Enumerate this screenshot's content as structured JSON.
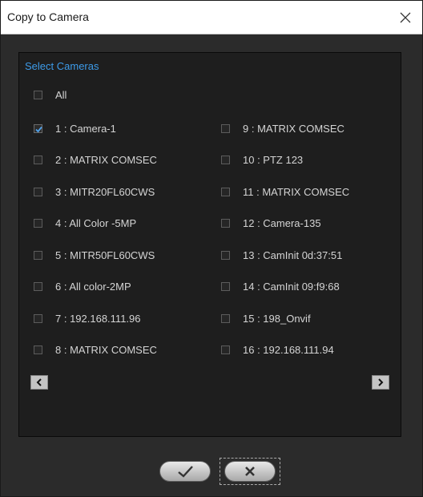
{
  "window": {
    "title": "Copy to Camera"
  },
  "panel": {
    "section_label": "Select Cameras"
  },
  "all_option": {
    "label": "All",
    "checked": false
  },
  "cameras_left": [
    {
      "label": "1 : Camera-1",
      "checked": true
    },
    {
      "label": "2 : MATRIX COMSEC",
      "checked": false
    },
    {
      "label": "3 : MITR20FL60CWS",
      "checked": false
    },
    {
      "label": "4 : All Color -5MP",
      "checked": false
    },
    {
      "label": "5 : MITR50FL60CWS",
      "checked": false
    },
    {
      "label": "6 : All color-2MP",
      "checked": false
    },
    {
      "label": "7 : 192.168.111.96",
      "checked": false
    },
    {
      "label": "8 : MATRIX COMSEC",
      "checked": false
    }
  ],
  "cameras_right": [
    {
      "label": "9 : MATRIX COMSEC",
      "checked": false
    },
    {
      "label": "10 : PTZ 123",
      "checked": false
    },
    {
      "label": "11 : MATRIX COMSEC",
      "checked": false
    },
    {
      "label": "12 : Camera-135",
      "checked": false
    },
    {
      "label": "13 : CamInit 0d:37:51",
      "checked": false
    },
    {
      "label": "14 : CamInit 09:f9:68",
      "checked": false
    },
    {
      "label": "15 : 198_Onvif",
      "checked": false
    },
    {
      "label": "16 : 192.168.111.94",
      "checked": false
    }
  ],
  "icons": {
    "close": "close-icon",
    "prev": "chevron-left-icon",
    "next": "chevron-right-icon",
    "ok": "checkmark-icon",
    "cancel": "x-icon"
  },
  "colors": {
    "background": "#2b2b2b",
    "panel": "#1e1e1e",
    "accent": "#3d9be9",
    "text": "#d4d4d4"
  }
}
